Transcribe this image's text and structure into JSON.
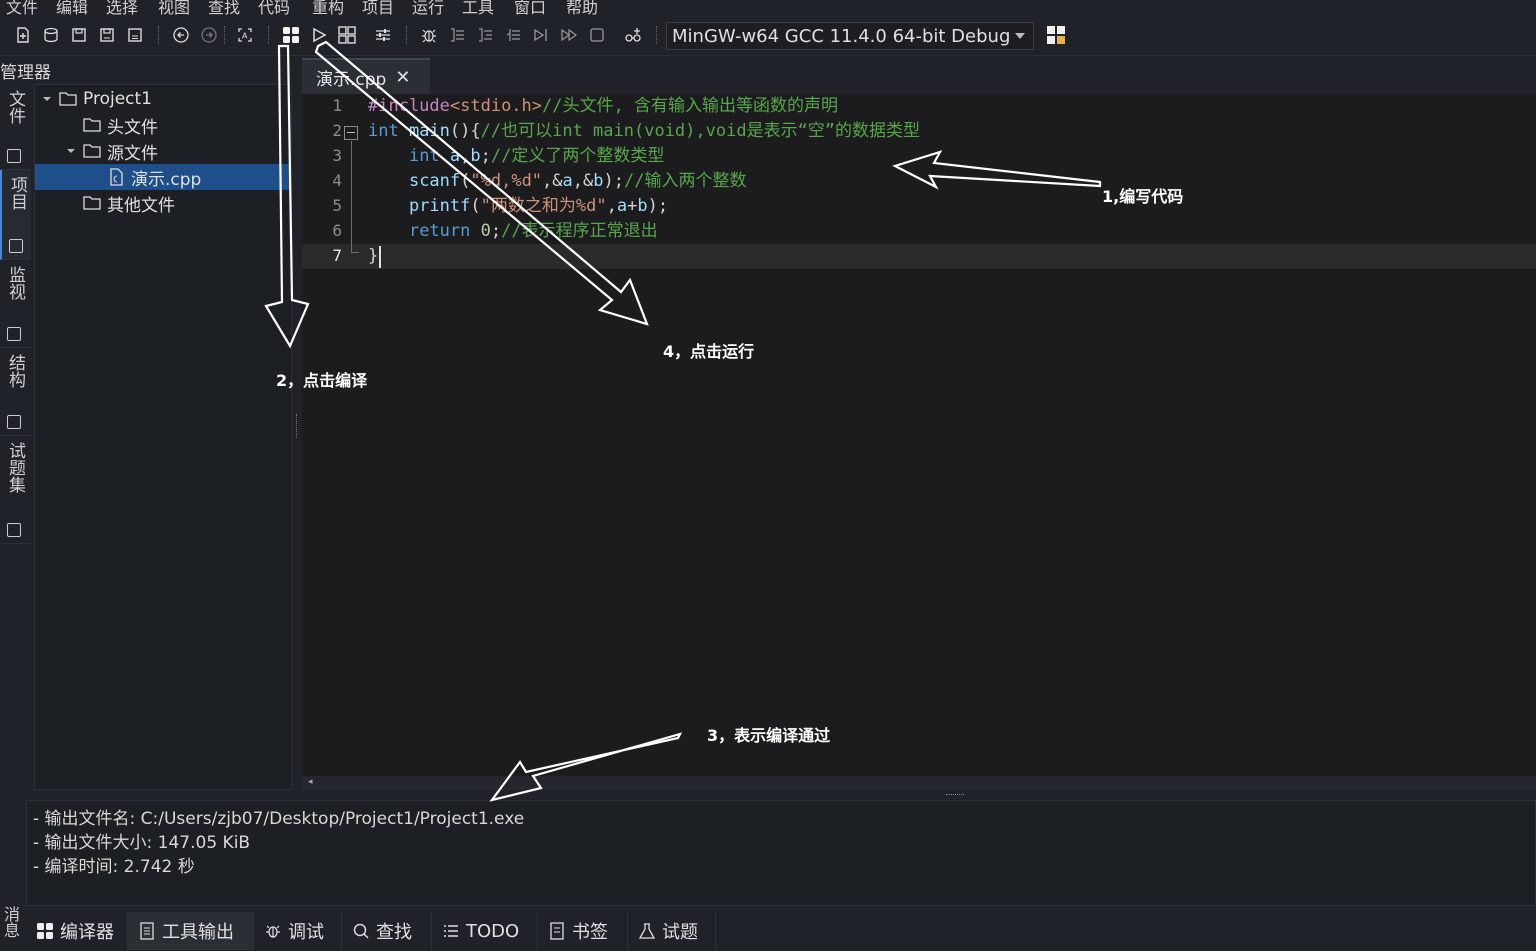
{
  "menu": [
    "文件",
    "编辑",
    "选择",
    "视图",
    "查找",
    "代码",
    "重构",
    "项目",
    "运行",
    "工具",
    "窗口",
    "帮助"
  ],
  "toolbar": {
    "compiler": "MinGW-w64 GCC 11.4.0 64-bit Debug",
    "icons": [
      "new-file-icon",
      "open-icon",
      "save-icon",
      "save-all-icon",
      "close-icon",
      "back-icon",
      "forward-icon",
      "zoom-icon",
      "compile-icon",
      "run-icon",
      "compile-run-icon",
      "options-icon",
      "debug-icon",
      "step-icon",
      "step-into-icon",
      "step-out-icon",
      "run-to-cursor-icon",
      "continue-icon",
      "stop-icon",
      "add-watch-icon",
      "compiler-options-icon"
    ]
  },
  "side_tabs": [
    "文件",
    "项目",
    "监视",
    "结构",
    "试题集"
  ],
  "panel": {
    "title": "管理器",
    "tree": [
      {
        "label": "Project1",
        "level": 0,
        "expanded": true,
        "type": "project"
      },
      {
        "label": "头文件",
        "level": 1,
        "type": "folder"
      },
      {
        "label": "源文件",
        "level": 1,
        "expanded": true,
        "type": "folder"
      },
      {
        "label": "演示.cpp",
        "level": 2,
        "type": "file",
        "selected": true
      },
      {
        "label": "其他文件",
        "level": 1,
        "type": "folder"
      }
    ]
  },
  "editor": {
    "tab": "演示.cpp",
    "current_line": 7,
    "lines": [
      {
        "n": "1",
        "tokens": [
          [
            "pp",
            "#include"
          ],
          [
            "str",
            "<stdio.h>"
          ],
          [
            "cm",
            "//头文件, 含有输入输出等函数的声明"
          ]
        ]
      },
      {
        "n": "2",
        "tokens": [
          [
            "kw",
            "int"
          ],
          [
            "pn",
            " "
          ],
          [
            "id",
            "main"
          ],
          [
            "pn",
            "(){"
          ],
          [
            "cm",
            "//也可以int main(void),void是表示“空”的数据类型"
          ]
        ]
      },
      {
        "n": "3",
        "tokens": [
          [
            "pn",
            "    "
          ],
          [
            "kw",
            "int"
          ],
          [
            "pn",
            " "
          ],
          [
            "id",
            "a"
          ],
          [
            "pn",
            ","
          ],
          [
            "id",
            "b"
          ],
          [
            "pn",
            ";"
          ],
          [
            "cm",
            "//定义了两个整数类型"
          ]
        ]
      },
      {
        "n": "4",
        "tokens": [
          [
            "pn",
            "    "
          ],
          [
            "id",
            "scanf"
          ],
          [
            "pn",
            "("
          ],
          [
            "str",
            "\"%d,%d\""
          ],
          [
            "pn",
            ",&"
          ],
          [
            "id",
            "a"
          ],
          [
            "pn",
            ",&"
          ],
          [
            "id",
            "b"
          ],
          [
            "pn",
            ");"
          ],
          [
            "cm",
            "//输入两个整数"
          ]
        ]
      },
      {
        "n": "5",
        "tokens": [
          [
            "pn",
            "    "
          ],
          [
            "id",
            "printf"
          ],
          [
            "pn",
            "("
          ],
          [
            "str",
            "\"两数之和为%d\""
          ],
          [
            "pn",
            ","
          ],
          [
            "id",
            "a"
          ],
          [
            "pn",
            "+"
          ],
          [
            "id",
            "b"
          ],
          [
            "pn",
            ");"
          ]
        ]
      },
      {
        "n": "6",
        "tokens": [
          [
            "pn",
            "    "
          ],
          [
            "kw",
            "return"
          ],
          [
            "pn",
            " "
          ],
          [
            "num",
            "0"
          ],
          [
            "pn",
            ";"
          ],
          [
            "cm",
            "//表示程序正常退出"
          ]
        ]
      },
      {
        "n": "7",
        "tokens": [
          [
            "pn",
            "}"
          ]
        ]
      }
    ]
  },
  "messages": [
    "- 输出文件名: C:/Users/zjb07/Desktop/Project1/Project1.exe",
    "- 输出文件大小: 147.05 KiB",
    "- 编译时间: 2.742 秒"
  ],
  "messages_label": "消息",
  "bottom_tabs": [
    {
      "label": "编译器",
      "icon": "compiler-icon"
    },
    {
      "label": "工具输出",
      "icon": "tool-output-icon",
      "active": true
    },
    {
      "label": "调试",
      "icon": "debug-icon"
    },
    {
      "label": "查找",
      "icon": "search-icon"
    },
    {
      "label": "TODO",
      "icon": "todo-icon"
    },
    {
      "label": "书签",
      "icon": "bookmark-icon"
    },
    {
      "label": "试题",
      "icon": "problem-icon"
    }
  ],
  "annotations": {
    "a1": "1,编写代码",
    "a2": "2，点击编译",
    "a3": "3，表示编译通过",
    "a4": "4，点击运行"
  },
  "colors": {
    "accent": "#1f4f8a",
    "annotation": "#ffffff"
  }
}
